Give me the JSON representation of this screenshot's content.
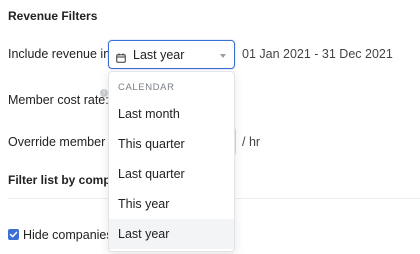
{
  "section": {
    "title": "Revenue Filters"
  },
  "include_revenue": {
    "label": "Include revenue in:",
    "selected": "Last year",
    "date_range": "01 Jan 2021 - 31 Dec 2021"
  },
  "member_cost": {
    "label": "Member cost rate:"
  },
  "override": {
    "label": "Override member co",
    "unit": "/ hr"
  },
  "filter_list": {
    "label": "Filter list by compan"
  },
  "hide_companies": {
    "label": "Hide companies v",
    "checked": true
  },
  "dropdown": {
    "header": "CALENDAR",
    "items": [
      {
        "label": "Last month"
      },
      {
        "label": "This quarter"
      },
      {
        "label": "Last quarter"
      },
      {
        "label": "This year"
      },
      {
        "label": "Last year",
        "selected": true
      }
    ]
  },
  "colors": {
    "accent": "#3b6fd4"
  },
  "icons": {
    "select_icon": "calendar-icon",
    "select_arrow": "chevron-down-icon",
    "info": "info-icon",
    "checkbox": "check-icon"
  }
}
